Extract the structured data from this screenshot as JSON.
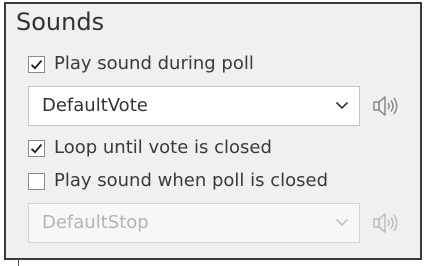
{
  "section": {
    "title": "Sounds"
  },
  "options": {
    "play_during_poll": {
      "label": "Play sound during poll",
      "checked": true
    },
    "loop_until_closed": {
      "label": "Loop until vote is closed",
      "checked": true
    },
    "play_when_closed": {
      "label": "Play sound when poll is closed",
      "checked": false
    }
  },
  "poll_sound_select": {
    "value": "DefaultVote",
    "enabled": true
  },
  "close_sound_select": {
    "value": "DefaultStop",
    "enabled": false
  },
  "icons": {
    "checkmark": "check-icon",
    "dropdown": "chevron-down-icon",
    "preview": "speaker-icon"
  }
}
